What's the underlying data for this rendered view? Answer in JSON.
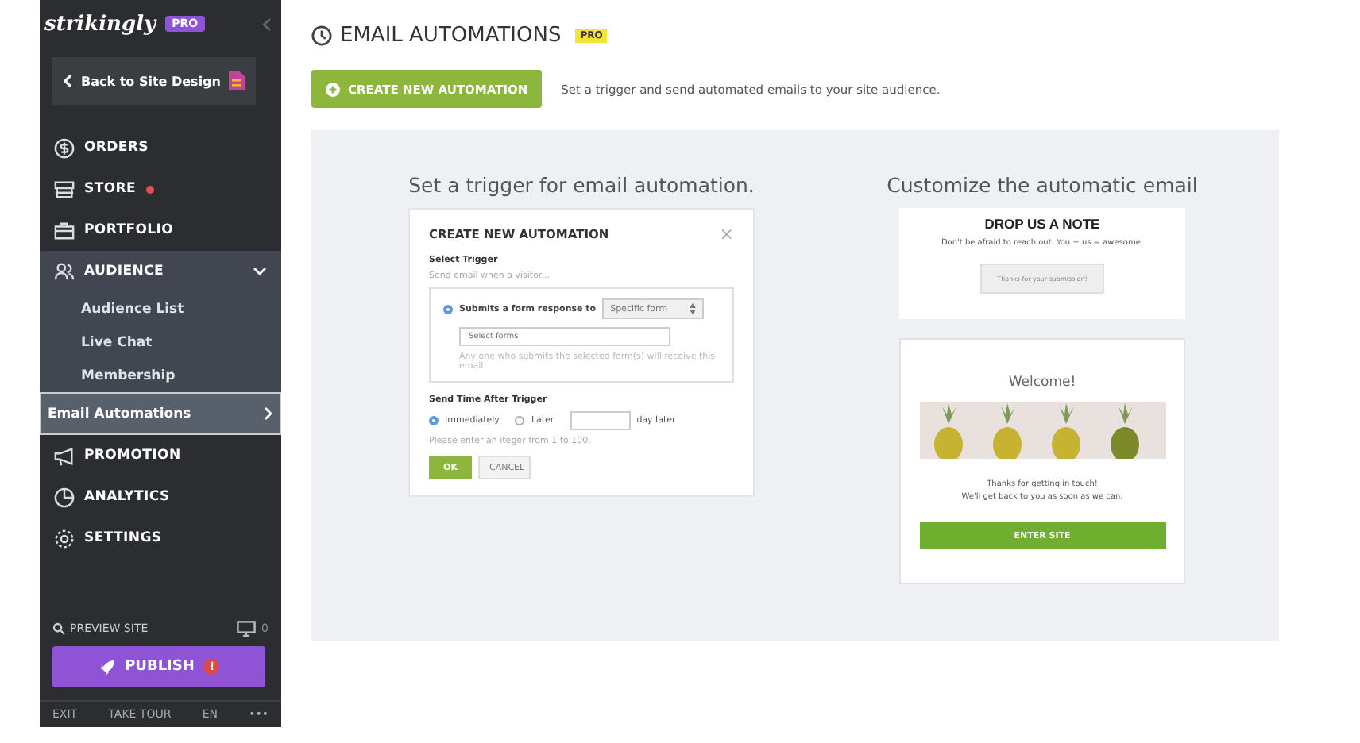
{
  "sidebar": {
    "logo": "strikingly",
    "logo_badge": "PRO",
    "back_button": "Back to Site Design",
    "nav": [
      {
        "label": "ORDERS",
        "expanded": false
      },
      {
        "label": "STORE",
        "expanded": false,
        "alert": true
      },
      {
        "label": "PORTFOLIO",
        "expanded": false
      },
      {
        "label": "AUDIENCE",
        "expanded": true,
        "children": [
          {
            "label": "Audience List",
            "selected": false
          },
          {
            "label": "Live Chat",
            "selected": false
          },
          {
            "label": "Membership",
            "selected": false
          },
          {
            "label": "Email Automations",
            "selected": true
          }
        ]
      },
      {
        "label": "PROMOTION",
        "expanded": false
      },
      {
        "label": "ANALYTICS",
        "expanded": false
      },
      {
        "label": "SETTINGS",
        "expanded": false
      }
    ],
    "preview": "PREVIEW SITE",
    "device_count": "0",
    "publish": "PUBLISH",
    "publish_alert": "!",
    "footer": [
      "EXIT",
      "TAKE TOUR",
      "EN",
      "•••"
    ]
  },
  "header": {
    "title": "EMAIL AUTOMATIONS",
    "badge": "PRO",
    "create_button": "CREATE NEW AUTOMATION",
    "description": "Set a trigger and send automated emails to your site audience."
  },
  "illustration": {
    "left_heading": "Set a trigger for email automation.",
    "right_heading": "Customize the automatic email",
    "dialog": {
      "title": "CREATE NEW AUTOMATION",
      "close": "×",
      "select_trigger": "Select Trigger",
      "trigger_hint": "Send email when a visitor...",
      "trigger_option": {
        "label": "Submits a form response to",
        "selected": true
      },
      "form_select": "Specific form",
      "forms_placeholder": "Select forms",
      "forms_note": "Any one who submits the selected form(s) will receive this email.",
      "send_time": "Send Time After Trigger",
      "timing": [
        {
          "label": "Immediately",
          "selected": true
        },
        {
          "label": "Later",
          "selected": false
        }
      ],
      "day_suffix": "day later",
      "day_hint": "Please enter an iteger  from 1 to 100.",
      "ok": "OK",
      "cancel": "CANCEL"
    },
    "form_card": {
      "heading": "DROP US A NOTE",
      "text": "Don't be afraid to reach out. You + us = awesome.",
      "button": "Thanks for your submission!"
    },
    "email_card": {
      "heading": "Welcome!",
      "lines": [
        "Thanks for getting in touch!",
        "We'll get back to you as soon as we can."
      ],
      "button": "ENTER SITE"
    }
  }
}
